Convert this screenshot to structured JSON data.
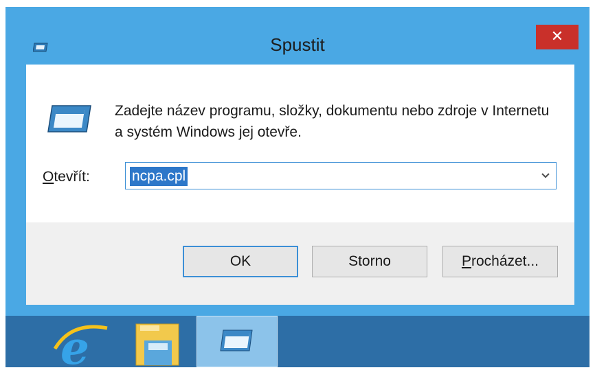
{
  "window": {
    "title": "Spustit",
    "close_glyph": "✕",
    "description": "Zadejte název programu, složky, dokumentu nebo zdroje v Internetu a systém Windows jej otevře.",
    "open_label_mnemonic": "O",
    "open_label_rest": "tevřít:",
    "combo_value": "ncpa.cpl"
  },
  "buttons": {
    "ok": "OK",
    "cancel": "Storno",
    "browse_mnemonic": "P",
    "browse_rest": "rocházet..."
  },
  "icons": {
    "title": "run-dialog-icon",
    "main": "run-program-icon",
    "taskbar": [
      "internet-explorer-icon",
      "file-explorer-icon",
      "run-dialog-icon"
    ]
  },
  "colors": {
    "frame": "#4aa8e4",
    "close": "#c9302a",
    "taskbar": "#2d6ea6",
    "selection": "#2d77c9"
  }
}
